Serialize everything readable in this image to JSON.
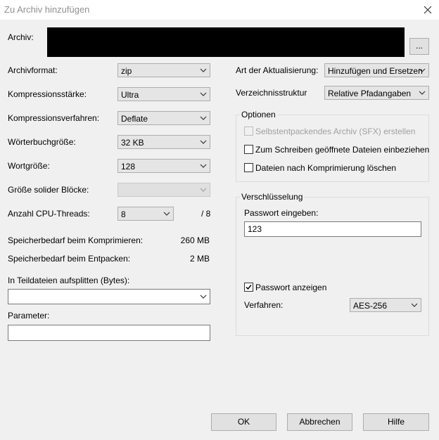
{
  "window": {
    "title": "Zu Archiv hinzufügen"
  },
  "archive": {
    "label": "Archiv:",
    "path_value": "",
    "browse_label": "..."
  },
  "left": {
    "format": {
      "label": "Archivformat:",
      "value": "zip"
    },
    "level": {
      "label": "Kompressionsstärke:",
      "value": "Ultra"
    },
    "method": {
      "label": "Kompressionsverfahren:",
      "value": "Deflate"
    },
    "dict": {
      "label": "Wörterbuchgröße:",
      "value": "32 KB"
    },
    "word": {
      "label": "Wortgröße:",
      "value": "128"
    },
    "solid": {
      "label": "Größe solider Blöcke:",
      "value": ""
    },
    "threads": {
      "label": "Anzahl CPU-Threads:",
      "value": "8",
      "max": "/ 8"
    },
    "mem_compress": {
      "label": "Speicherbedarf beim Komprimieren:",
      "value": "260 MB"
    },
    "mem_extract": {
      "label": "Speicherbedarf beim Entpacken:",
      "value": "2 MB"
    },
    "split": {
      "label": "In Teildateien aufsplitten (Bytes):",
      "value": ""
    },
    "params": {
      "label": "Parameter:",
      "value": ""
    }
  },
  "right": {
    "update_mode": {
      "label": "Art der Aktualisierung:",
      "value": "Hinzufügen und Ersetzen"
    },
    "path_mode": {
      "label": "Verzeichnisstruktur",
      "value": "Relative Pfadangaben"
    },
    "options": {
      "title": "Optionen",
      "sfx": {
        "label": "Selbstentpackendes Archiv (SFX) erstellen",
        "checked": false,
        "enabled": false
      },
      "shared": {
        "label": "Zum Schreiben geöffnete Dateien einbeziehen",
        "checked": false
      },
      "delete": {
        "label": "Dateien nach Komprimierung löschen",
        "checked": false
      }
    },
    "encryption": {
      "title": "Verschlüsselung",
      "password_label": "Passwort eingeben:",
      "password_value": "123",
      "show_label": "Passwort anzeigen",
      "show_checked": true,
      "method_label": "Verfahren:",
      "method_value": "AES-256"
    }
  },
  "buttons": {
    "ok": "OK",
    "cancel": "Abbrechen",
    "help": "Hilfe"
  },
  "icons": {
    "close": "close-icon",
    "dropdown": "chevron-down-icon",
    "check": "checkmark-icon"
  }
}
